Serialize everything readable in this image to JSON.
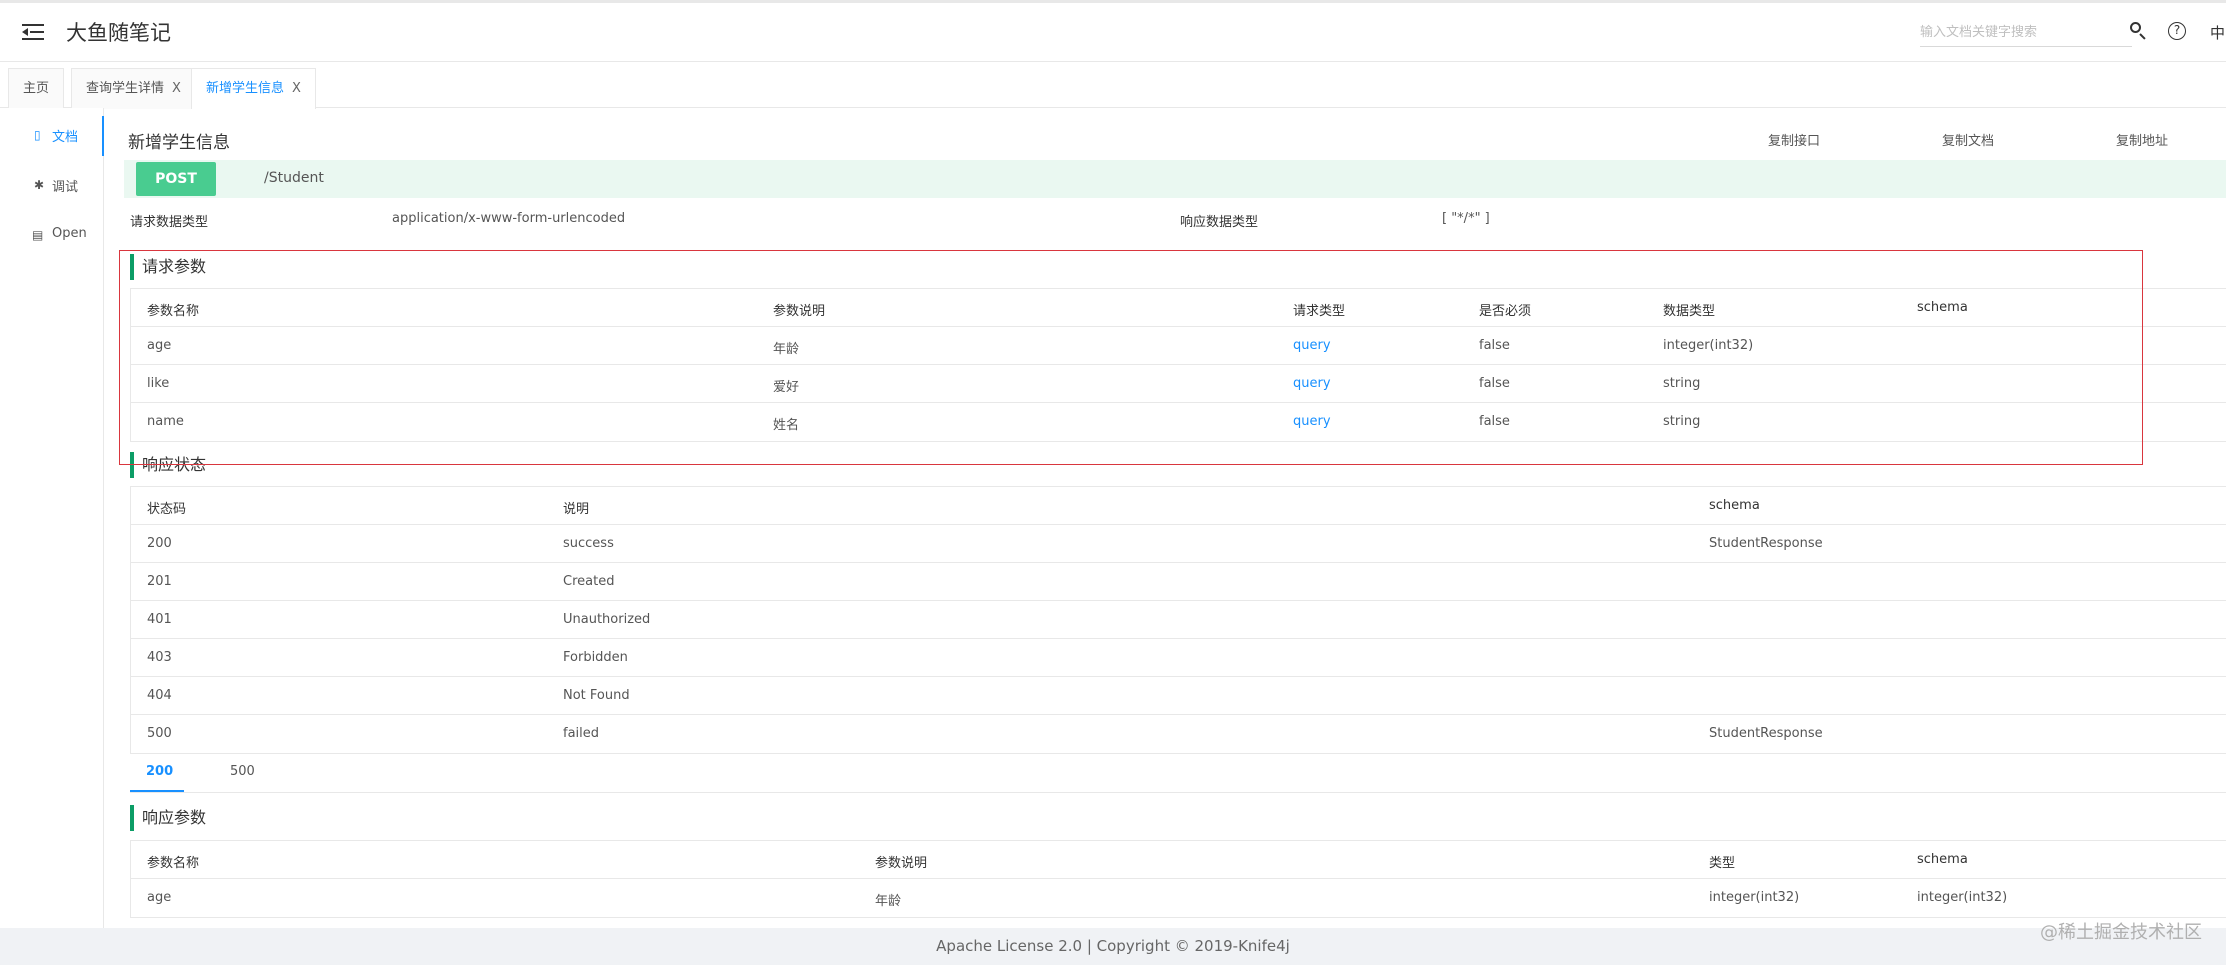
{
  "header": {
    "app_title": "大鱼随笔记",
    "search_placeholder": "输入文档关键字搜索",
    "help_symbol": "?",
    "lang_label": "中"
  },
  "tabs": [
    {
      "label": "主页",
      "closable": false
    },
    {
      "label": "查询学生详情",
      "closable": true
    },
    {
      "label": "新增学生信息",
      "closable": true,
      "active": true
    }
  ],
  "close_glyph": "X",
  "sidebar": {
    "items": [
      {
        "icon": "document-icon",
        "glyph": "▯",
        "label": "文档",
        "active": true
      },
      {
        "icon": "bug-icon",
        "glyph": "✱",
        "label": "调试"
      },
      {
        "icon": "file-icon",
        "glyph": "▤",
        "label": "Open"
      }
    ]
  },
  "api": {
    "title": "新增学生信息",
    "actions": {
      "copy_api": "复制接口",
      "copy_doc": "复制文档",
      "copy_url": "复制地址"
    },
    "method": "POST",
    "path": "/Student",
    "request_type_label": "请求数据类型",
    "request_type_value": "application/x-www-form-urlencoded",
    "response_type_label": "响应数据类型",
    "response_type_value": "[ \"*/*\" ]"
  },
  "request_params": {
    "heading": "请求参数",
    "columns": {
      "name": "参数名称",
      "desc": "参数说明",
      "in": "请求类型",
      "required": "是否必须",
      "type": "数据类型",
      "schema": "schema"
    },
    "rows": [
      {
        "name": "age",
        "desc": "年龄",
        "in": "query",
        "required": "false",
        "type": "integer(int32)"
      },
      {
        "name": "like",
        "desc": "爱好",
        "in": "query",
        "required": "false",
        "type": "string"
      },
      {
        "name": "name",
        "desc": "姓名",
        "in": "query",
        "required": "false",
        "type": "string"
      }
    ]
  },
  "response_status": {
    "heading": "响应状态",
    "columns": {
      "code": "状态码",
      "desc": "说明",
      "schema": "schema"
    },
    "rows": [
      {
        "code": "200",
        "desc": "success",
        "schema": "StudentResponse"
      },
      {
        "code": "201",
        "desc": "Created",
        "schema": ""
      },
      {
        "code": "401",
        "desc": "Unauthorized",
        "schema": ""
      },
      {
        "code": "403",
        "desc": "Forbidden",
        "schema": ""
      },
      {
        "code": "404",
        "desc": "Not Found",
        "schema": ""
      },
      {
        "code": "500",
        "desc": "failed",
        "schema": "StudentResponse"
      }
    ]
  },
  "response_tabs": [
    "200",
    "500"
  ],
  "response_params": {
    "heading": "响应参数",
    "columns": {
      "name": "参数名称",
      "desc": "参数说明",
      "type": "类型",
      "schema": "schema"
    },
    "rows": [
      {
        "name": "age",
        "desc": "年龄",
        "type": "integer(int32)",
        "schema": "integer(int32)"
      }
    ]
  },
  "footer": {
    "text": "Apache License 2.0 | Copyright © 2019-Knife4j"
  },
  "watermark": "@稀土掘金技术社区",
  "colors": {
    "accent": "#1890ff",
    "post_green": "#49cc90",
    "section_bar": "#0c9d66",
    "highlight_red": "#d9363e"
  }
}
